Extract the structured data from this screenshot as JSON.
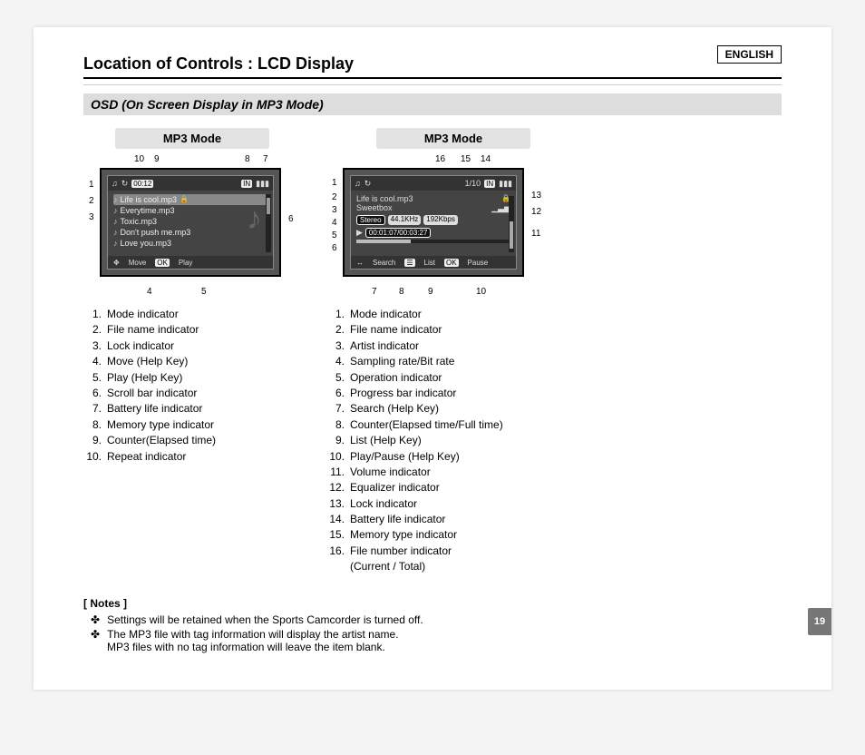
{
  "language": "ENGLISH",
  "title": "Location of Controls : LCD Display",
  "subtitle": "OSD (On Screen Display in MP3 Mode)",
  "page_number": "19",
  "left": {
    "header": "MP3 Mode",
    "screen": {
      "time": "00:12",
      "mem": "IN",
      "selected": "Life is cool.mp3",
      "files": [
        "Everytime.mp3",
        "Toxic.mp3",
        "Don't push me.mp3",
        "Love you.mp3"
      ],
      "help_move": "Move",
      "help_play": "Play",
      "ok": "OK"
    },
    "labels_top": {
      "10": "10",
      "9": "9",
      "8": "8",
      "7": "7"
    },
    "labels_left": {
      "1": "1",
      "2": "2",
      "3": "3"
    },
    "labels_right": {
      "6": "6"
    },
    "labels_bottom": {
      "4": "4",
      "5": "5"
    },
    "legend": [
      {
        "n": "1.",
        "t": "Mode indicator"
      },
      {
        "n": "2.",
        "t": "File name indicator"
      },
      {
        "n": "3.",
        "t": "Lock indicator"
      },
      {
        "n": "4.",
        "t": "Move (Help Key)"
      },
      {
        "n": "5.",
        "t": "Play (Help Key)"
      },
      {
        "n": "6.",
        "t": "Scroll bar indicator"
      },
      {
        "n": "7.",
        "t": "Battery life indicator"
      },
      {
        "n": "8.",
        "t": "Memory type indicator"
      },
      {
        "n": "9.",
        "t": "Counter(Elapsed time)"
      },
      {
        "n": "10.",
        "t": "Repeat indicator"
      }
    ]
  },
  "right": {
    "header": "MP3 Mode",
    "screen": {
      "file_no": "1/10",
      "mem": "IN",
      "file": "Life is cool.mp3",
      "artist": "Sweetbox",
      "stereo": "Stereo",
      "rate": "44.1KHz",
      "bitrate": "192Kbps",
      "op": "▶",
      "counter": "00:01:07/00:03:27",
      "help_search": "Search",
      "help_list": "List",
      "help_pause": "Pause",
      "ok": "OK"
    },
    "labels_top": {
      "16": "16",
      "15": "15",
      "14": "14"
    },
    "labels_left": {
      "1": "1",
      "2": "2",
      "3": "3",
      "4": "4",
      "5": "5",
      "6": "6"
    },
    "labels_right": {
      "13": "13",
      "12": "12",
      "11": "11"
    },
    "labels_bottom": {
      "7": "7",
      "8": "8",
      "9": "9",
      "10": "10"
    },
    "legend": [
      {
        "n": "1.",
        "t": "Mode indicator"
      },
      {
        "n": "2.",
        "t": "File name indicator"
      },
      {
        "n": "3.",
        "t": "Artist indicator"
      },
      {
        "n": "4.",
        "t": "Sampling rate/Bit rate"
      },
      {
        "n": "5.",
        "t": "Operation indicator"
      },
      {
        "n": "6.",
        "t": "Progress bar indicator"
      },
      {
        "n": "7.",
        "t": "Search (Help Key)"
      },
      {
        "n": "8.",
        "t": "Counter(Elapsed time/Full time)"
      },
      {
        "n": "9.",
        "t": "List (Help Key)"
      },
      {
        "n": "10.",
        "t": "Play/Pause (Help Key)"
      },
      {
        "n": "11.",
        "t": "Volume indicator"
      },
      {
        "n": "12.",
        "t": "Equalizer indicator"
      },
      {
        "n": "13.",
        "t": "Lock indicator"
      },
      {
        "n": "14.",
        "t": "Battery life indicator"
      },
      {
        "n": "15.",
        "t": "Memory type indicator"
      },
      {
        "n": "16.",
        "t": "File number indicator"
      },
      {
        "n": "",
        "t": "(Current / Total)"
      }
    ]
  },
  "notes": {
    "title": "[ Notes ]",
    "bullet": "✤",
    "lines": [
      "Settings will be retained when the Sports Camcorder is turned off.",
      "The MP3 file with tag information will display the artist name."
    ],
    "sub": "MP3 files with no tag information will leave the item blank."
  }
}
